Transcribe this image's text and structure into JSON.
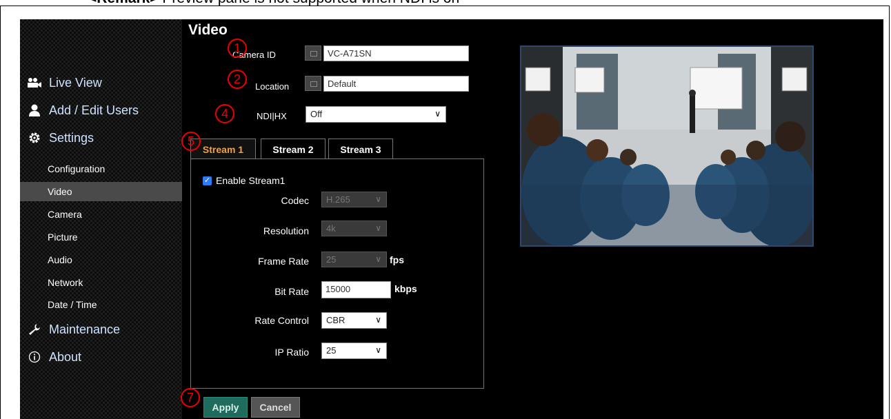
{
  "remark": {
    "prefix": "<Remark>",
    "text": " Preview pane is not supported when NDI is on"
  },
  "page": {
    "title": "Video"
  },
  "sidebar": {
    "main": [
      {
        "label": "Live View",
        "icon": "live-view-icon"
      },
      {
        "label": "Add / Edit Users",
        "icon": "user-icon"
      },
      {
        "label": "Settings",
        "icon": "gear-icon"
      },
      {
        "label": "Maintenance",
        "icon": "wrench-icon"
      },
      {
        "label": "About",
        "icon": "info-icon"
      }
    ],
    "sub": [
      {
        "label": "Configuration"
      },
      {
        "label": "Video",
        "active": true
      },
      {
        "label": "Camera"
      },
      {
        "label": "Picture"
      },
      {
        "label": "Audio"
      },
      {
        "label": "Network"
      },
      {
        "label": "Date / Time"
      }
    ]
  },
  "form": {
    "camera_id": {
      "label": "Camera ID",
      "value": "VC-A71SN"
    },
    "location": {
      "label": "Location",
      "value": "Default"
    },
    "ndi": {
      "label": "NDI|HX",
      "value": "Off"
    }
  },
  "tabs": [
    {
      "label": "Stream 1",
      "active": true
    },
    {
      "label": "Stream 2"
    },
    {
      "label": "Stream 3"
    }
  ],
  "stream": {
    "enable_label": "Enable Stream1",
    "enabled": true,
    "codec": {
      "label": "Codec",
      "value": "H.265"
    },
    "resolution": {
      "label": "Resolution",
      "value": "4k"
    },
    "frame_rate": {
      "label": "Frame Rate",
      "value": "25",
      "unit": "fps"
    },
    "bit_rate": {
      "label": "Bit Rate",
      "value": "15000",
      "unit": "kbps"
    },
    "rate_control": {
      "label": "Rate Control",
      "value": "CBR"
    },
    "ip_ratio": {
      "label": "IP Ratio",
      "value": "25"
    }
  },
  "buttons": {
    "apply": "Apply",
    "cancel": "Cancel"
  },
  "badges": {
    "b1": "1",
    "b2": "2",
    "b4": "4",
    "b5": "5",
    "b7": "7"
  },
  "colors": {
    "accent_tab": "#f5a040",
    "apply_bg": "#1f6b5e",
    "nav_text": "#cfe3ff",
    "badge": "#e00000"
  }
}
